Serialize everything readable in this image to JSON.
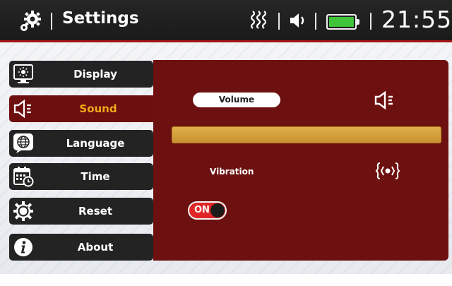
{
  "header": {
    "title": "Settings",
    "time": "21:55",
    "icons": [
      "settings-gear-icon",
      "vibration-icon",
      "speaker-icon",
      "battery-icon"
    ],
    "battery_level": 1.0
  },
  "sidebar": {
    "items": [
      {
        "label": "Display",
        "icon": "display-icon"
      },
      {
        "label": "Sound",
        "icon": "sound-icon",
        "active": true
      },
      {
        "label": "Language",
        "icon": "globe-icon"
      },
      {
        "label": "Time",
        "icon": "calendar-clock-icon"
      },
      {
        "label": "Reset",
        "icon": "reset-icon"
      },
      {
        "label": "About",
        "icon": "info-icon"
      }
    ]
  },
  "sound": {
    "volume_label": "Volume",
    "volume_level": 1.0,
    "vibration_label": "Vibration",
    "vibration_toggle": "ON"
  },
  "colors": {
    "accent": "#a61717",
    "panel": "#6d1010",
    "active_text": "#f0a91a",
    "slider": "#d6a23c",
    "toggle_on": "#e02626",
    "battery": "#3fc43a"
  }
}
